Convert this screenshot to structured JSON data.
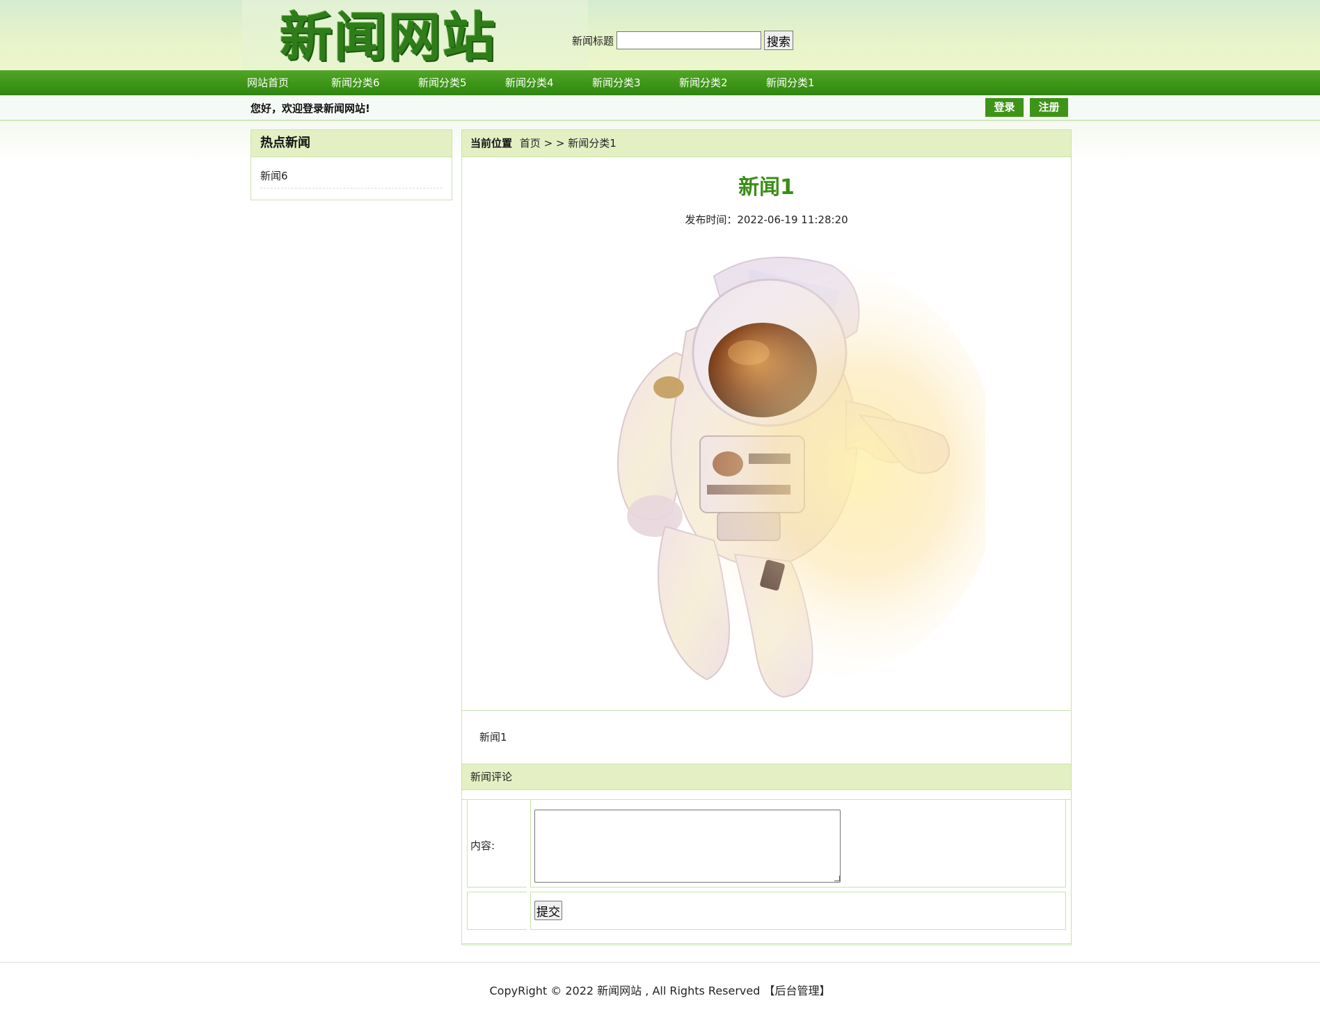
{
  "header": {
    "logo_text": "新闻网站",
    "search": {
      "label": "新闻标题",
      "value": "",
      "placeholder": "",
      "button_label": "搜索"
    }
  },
  "nav": {
    "items": [
      {
        "label": "网站首页"
      },
      {
        "label": "新闻分类6"
      },
      {
        "label": "新闻分类5"
      },
      {
        "label": "新闻分类4"
      },
      {
        "label": "新闻分类3"
      },
      {
        "label": "新闻分类2"
      },
      {
        "label": "新闻分类1"
      }
    ]
  },
  "user_bar": {
    "welcome": "您好，欢迎登录新闻网站!",
    "login_label": "登录",
    "register_label": "注册"
  },
  "sidebar": {
    "title": "热点新闻",
    "items": [
      {
        "label": "新闻6"
      }
    ]
  },
  "breadcrumb": {
    "label": "当前位置",
    "path": "首页 > > 新闻分类1"
  },
  "article": {
    "title": "新闻1",
    "publish_time": "发布时间：2022-06-19 11:28:20",
    "image": "astronaut-photo",
    "body": "新闻1"
  },
  "comments": {
    "title": "新闻评论",
    "content_label": "内容:",
    "content_value": "",
    "submit_label": "提交"
  },
  "footer": {
    "copyright": "CopyRight © 2022 新闻网站 , All Rights Reserved",
    "admin_link": "【后台管理】"
  },
  "colors": {
    "brand_green": "#3e9416",
    "title_green": "#3b8c16",
    "panel_header": "#e4f0c4",
    "panel_border": "#c8e3a8"
  }
}
